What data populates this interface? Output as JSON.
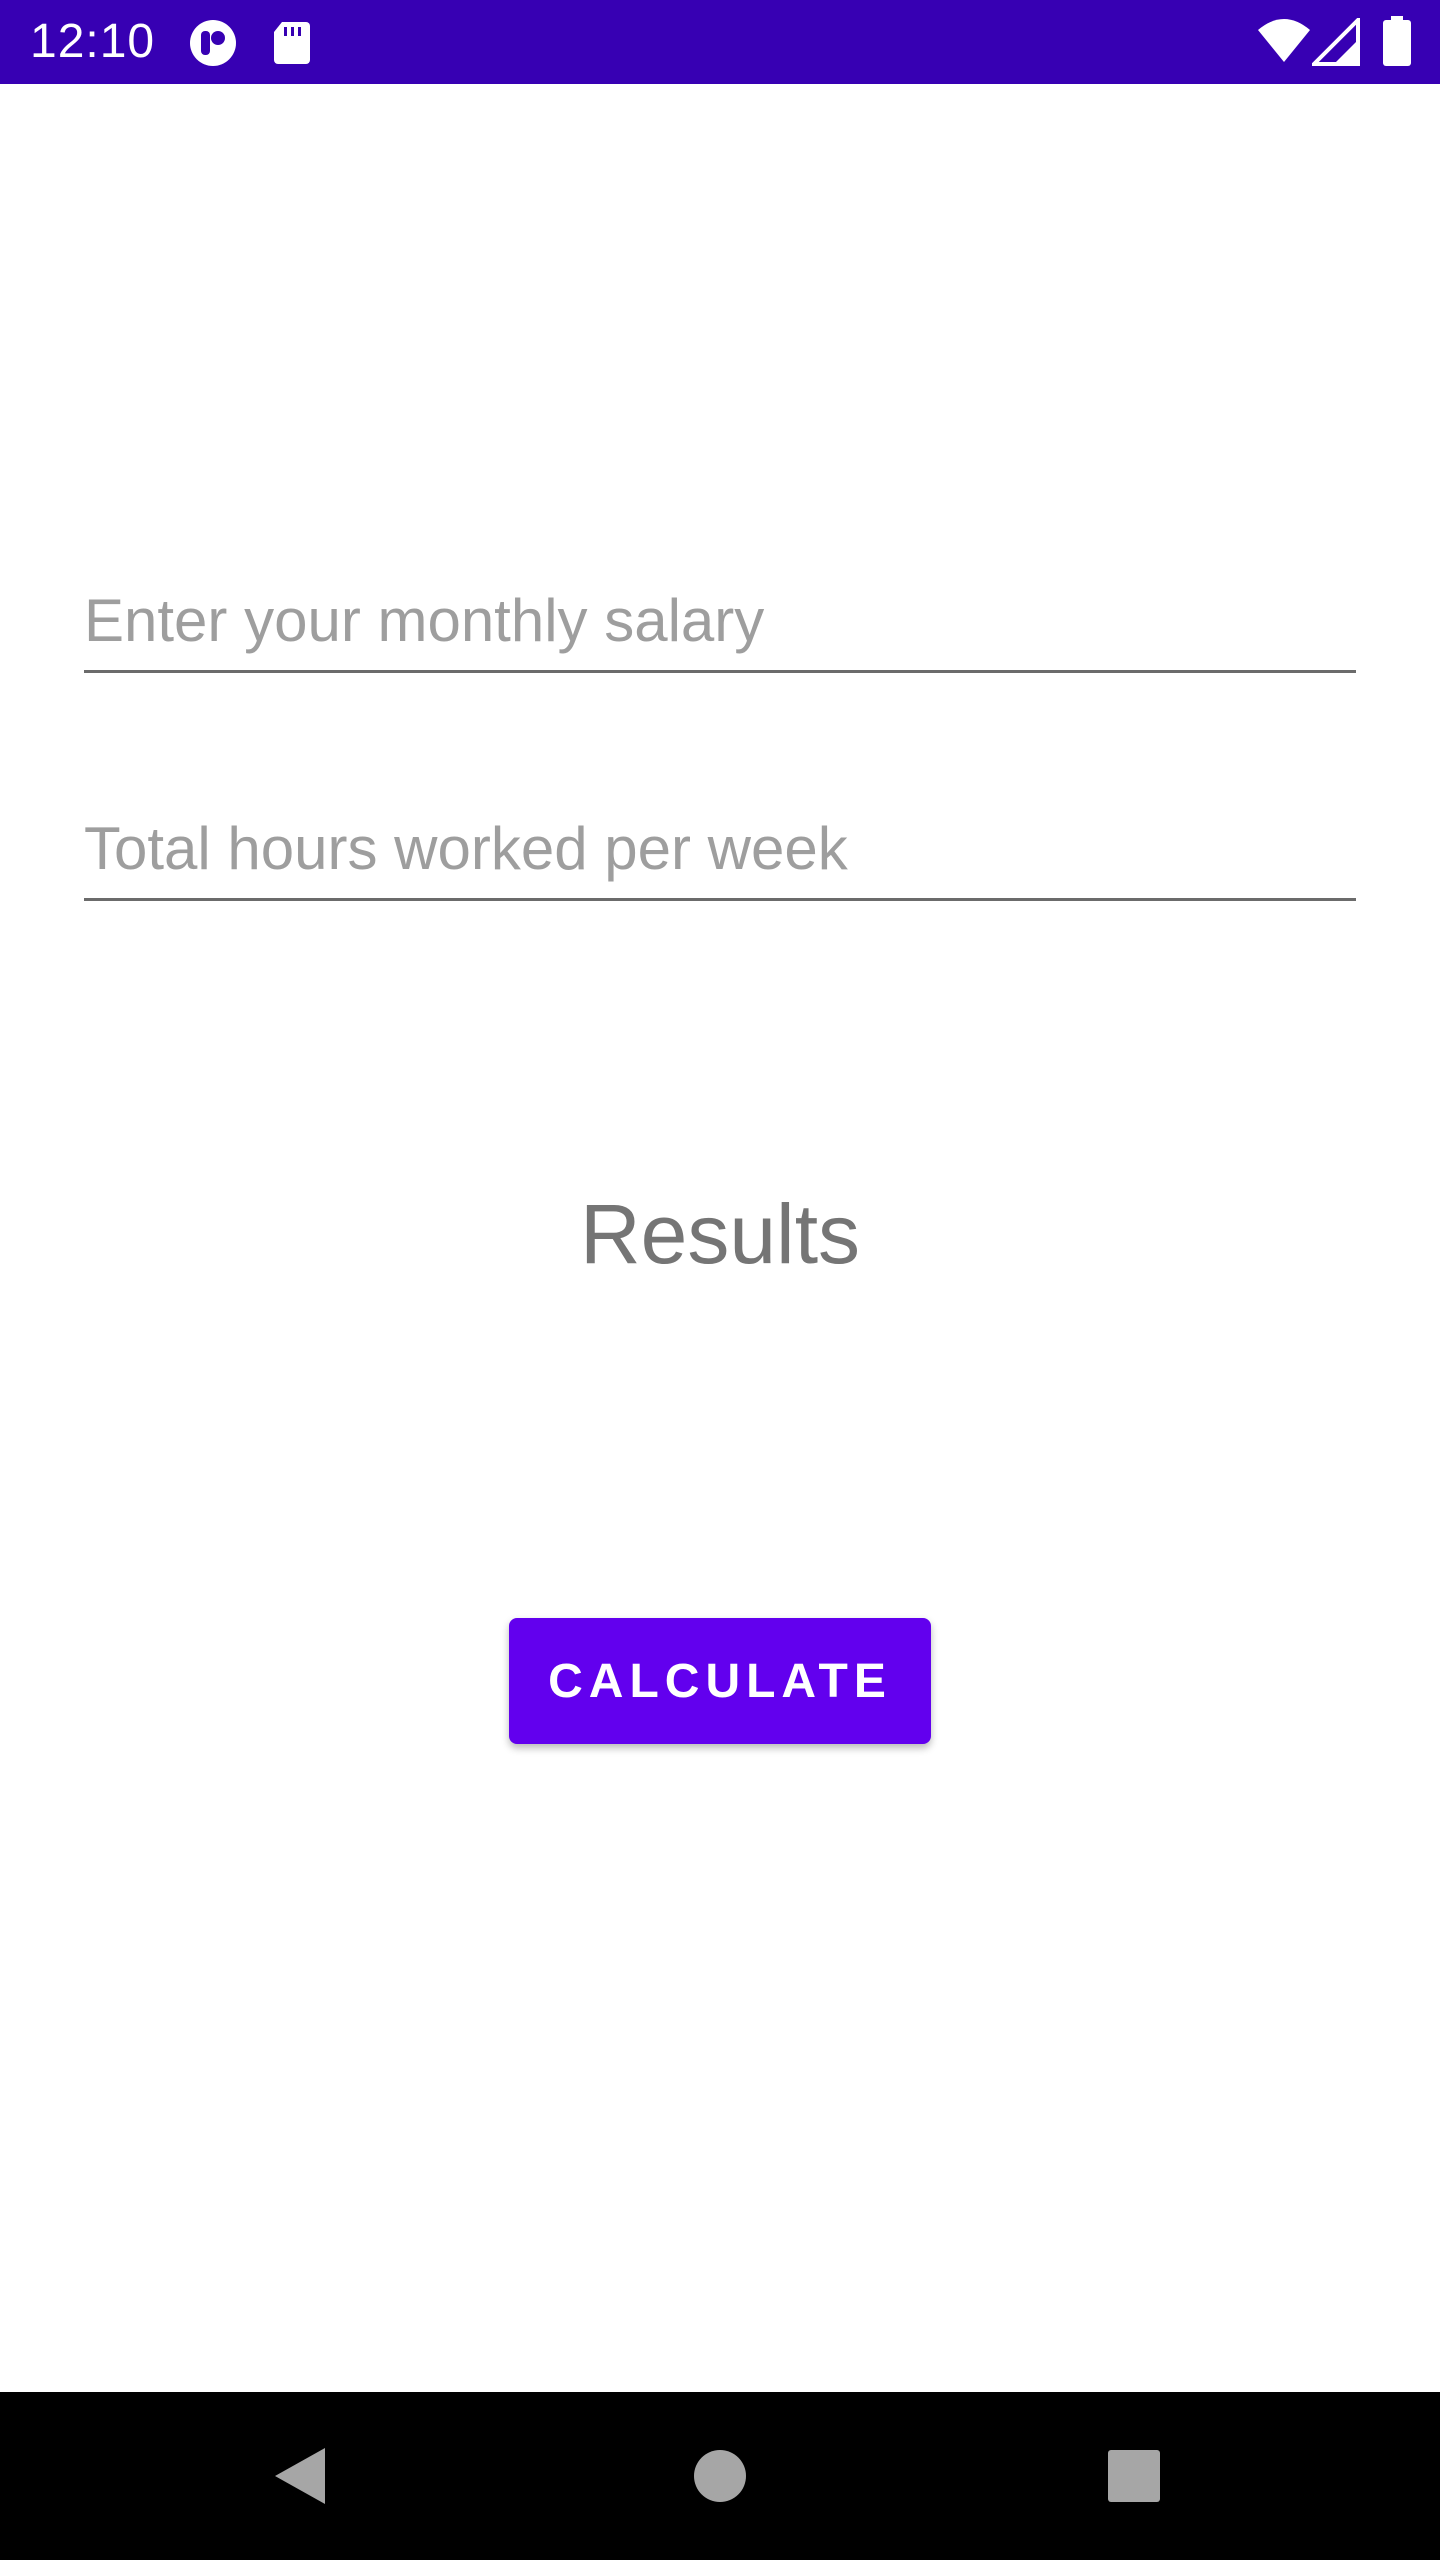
{
  "status_bar": {
    "time": "12:10",
    "background_color": "#3700b3",
    "left_icons": [
      "app-notification-icon",
      "sd-card-icon"
    ],
    "right_icons": [
      "wifi-icon",
      "cell-signal-icon",
      "battery-icon"
    ]
  },
  "form": {
    "salary_field": {
      "placeholder": "Enter your monthly salary",
      "value": ""
    },
    "hours_field": {
      "placeholder": "Total hours worked per week",
      "value": ""
    }
  },
  "results": {
    "label": "Results"
  },
  "calculate_button": {
    "label": "CALCULATE",
    "color": "#6200ee"
  },
  "nav_bar": {
    "buttons": [
      "back-icon",
      "home-icon",
      "recents-icon"
    ]
  }
}
